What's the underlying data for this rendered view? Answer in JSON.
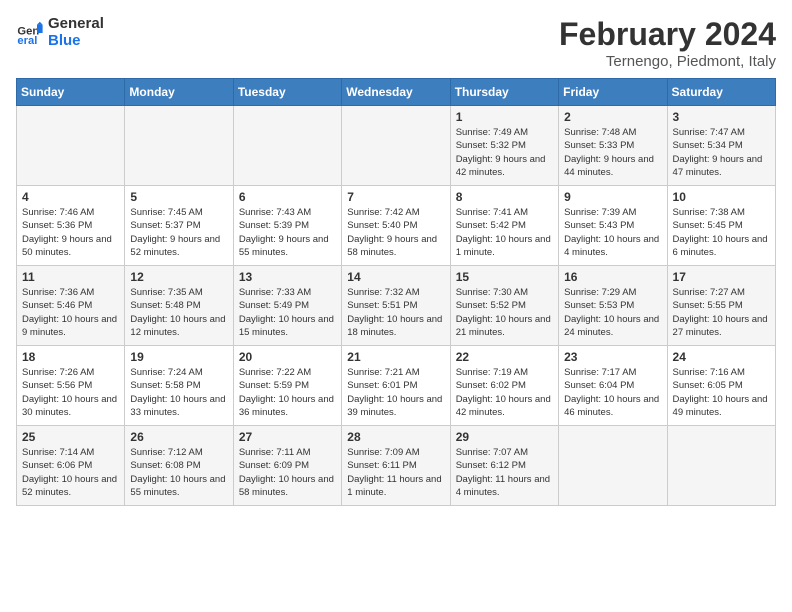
{
  "logo": {
    "text_general": "General",
    "text_blue": "Blue"
  },
  "title": "February 2024",
  "subtitle": "Ternengo, Piedmont, Italy",
  "days_of_week": [
    "Sunday",
    "Monday",
    "Tuesday",
    "Wednesday",
    "Thursday",
    "Friday",
    "Saturday"
  ],
  "weeks": [
    {
      "days": [
        {
          "num": "",
          "info": ""
        },
        {
          "num": "",
          "info": ""
        },
        {
          "num": "",
          "info": ""
        },
        {
          "num": "",
          "info": ""
        },
        {
          "num": "1",
          "info": "Sunrise: 7:49 AM\nSunset: 5:32 PM\nDaylight: 9 hours and 42 minutes."
        },
        {
          "num": "2",
          "info": "Sunrise: 7:48 AM\nSunset: 5:33 PM\nDaylight: 9 hours and 44 minutes."
        },
        {
          "num": "3",
          "info": "Sunrise: 7:47 AM\nSunset: 5:34 PM\nDaylight: 9 hours and 47 minutes."
        }
      ]
    },
    {
      "days": [
        {
          "num": "4",
          "info": "Sunrise: 7:46 AM\nSunset: 5:36 PM\nDaylight: 9 hours and 50 minutes."
        },
        {
          "num": "5",
          "info": "Sunrise: 7:45 AM\nSunset: 5:37 PM\nDaylight: 9 hours and 52 minutes."
        },
        {
          "num": "6",
          "info": "Sunrise: 7:43 AM\nSunset: 5:39 PM\nDaylight: 9 hours and 55 minutes."
        },
        {
          "num": "7",
          "info": "Sunrise: 7:42 AM\nSunset: 5:40 PM\nDaylight: 9 hours and 58 minutes."
        },
        {
          "num": "8",
          "info": "Sunrise: 7:41 AM\nSunset: 5:42 PM\nDaylight: 10 hours and 1 minute."
        },
        {
          "num": "9",
          "info": "Sunrise: 7:39 AM\nSunset: 5:43 PM\nDaylight: 10 hours and 4 minutes."
        },
        {
          "num": "10",
          "info": "Sunrise: 7:38 AM\nSunset: 5:45 PM\nDaylight: 10 hours and 6 minutes."
        }
      ]
    },
    {
      "days": [
        {
          "num": "11",
          "info": "Sunrise: 7:36 AM\nSunset: 5:46 PM\nDaylight: 10 hours and 9 minutes."
        },
        {
          "num": "12",
          "info": "Sunrise: 7:35 AM\nSunset: 5:48 PM\nDaylight: 10 hours and 12 minutes."
        },
        {
          "num": "13",
          "info": "Sunrise: 7:33 AM\nSunset: 5:49 PM\nDaylight: 10 hours and 15 minutes."
        },
        {
          "num": "14",
          "info": "Sunrise: 7:32 AM\nSunset: 5:51 PM\nDaylight: 10 hours and 18 minutes."
        },
        {
          "num": "15",
          "info": "Sunrise: 7:30 AM\nSunset: 5:52 PM\nDaylight: 10 hours and 21 minutes."
        },
        {
          "num": "16",
          "info": "Sunrise: 7:29 AM\nSunset: 5:53 PM\nDaylight: 10 hours and 24 minutes."
        },
        {
          "num": "17",
          "info": "Sunrise: 7:27 AM\nSunset: 5:55 PM\nDaylight: 10 hours and 27 minutes."
        }
      ]
    },
    {
      "days": [
        {
          "num": "18",
          "info": "Sunrise: 7:26 AM\nSunset: 5:56 PM\nDaylight: 10 hours and 30 minutes."
        },
        {
          "num": "19",
          "info": "Sunrise: 7:24 AM\nSunset: 5:58 PM\nDaylight: 10 hours and 33 minutes."
        },
        {
          "num": "20",
          "info": "Sunrise: 7:22 AM\nSunset: 5:59 PM\nDaylight: 10 hours and 36 minutes."
        },
        {
          "num": "21",
          "info": "Sunrise: 7:21 AM\nSunset: 6:01 PM\nDaylight: 10 hours and 39 minutes."
        },
        {
          "num": "22",
          "info": "Sunrise: 7:19 AM\nSunset: 6:02 PM\nDaylight: 10 hours and 42 minutes."
        },
        {
          "num": "23",
          "info": "Sunrise: 7:17 AM\nSunset: 6:04 PM\nDaylight: 10 hours and 46 minutes."
        },
        {
          "num": "24",
          "info": "Sunrise: 7:16 AM\nSunset: 6:05 PM\nDaylight: 10 hours and 49 minutes."
        }
      ]
    },
    {
      "days": [
        {
          "num": "25",
          "info": "Sunrise: 7:14 AM\nSunset: 6:06 PM\nDaylight: 10 hours and 52 minutes."
        },
        {
          "num": "26",
          "info": "Sunrise: 7:12 AM\nSunset: 6:08 PM\nDaylight: 10 hours and 55 minutes."
        },
        {
          "num": "27",
          "info": "Sunrise: 7:11 AM\nSunset: 6:09 PM\nDaylight: 10 hours and 58 minutes."
        },
        {
          "num": "28",
          "info": "Sunrise: 7:09 AM\nSunset: 6:11 PM\nDaylight: 11 hours and 1 minute."
        },
        {
          "num": "29",
          "info": "Sunrise: 7:07 AM\nSunset: 6:12 PM\nDaylight: 11 hours and 4 minutes."
        },
        {
          "num": "",
          "info": ""
        },
        {
          "num": "",
          "info": ""
        }
      ]
    }
  ]
}
